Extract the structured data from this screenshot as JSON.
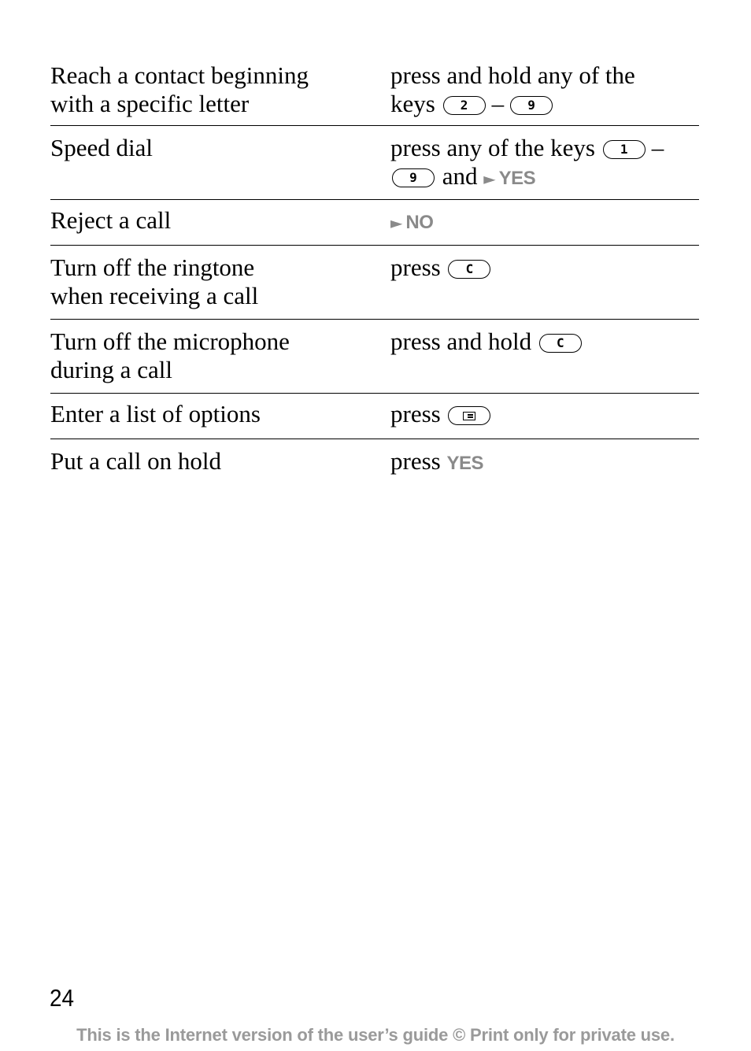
{
  "document": {
    "rows": [
      {
        "action": "Reach a contact beginning with a specific letter",
        "action_line1": "Reach a contact beginning",
        "action_line2": "with a specific letter",
        "how_line1": "press and hold any of the",
        "how_prefix": "keys",
        "key_from": "2",
        "range_dash": "–",
        "key_to": "9"
      },
      {
        "action": "Speed dial",
        "how_prefix": "press any of the keys",
        "key_from": "1",
        "range_dash": "–",
        "key_to": "9",
        "connector": "and",
        "soft_arrow": "►",
        "soft_key": "YES"
      },
      {
        "action": "Reject a call",
        "soft_arrow": "►",
        "soft_key": "NO"
      },
      {
        "action_line1": "Turn off the ringtone",
        "action_line2": "when receiving a call",
        "how_prefix": "press",
        "key": "C"
      },
      {
        "action_line1": "Turn off the microphone",
        "action_line2": "during a call",
        "how_prefix": "press and hold",
        "key": "C"
      },
      {
        "action": "Enter a list of options",
        "how_prefix": "press",
        "key_icon": "options-menu-key-icon"
      },
      {
        "action": "Put a call on hold",
        "how_prefix": "press",
        "soft_key": "YES"
      }
    ],
    "colors": {
      "text": "#000000",
      "soft_key": "#8a8a8a",
      "footer": "#9a9a9a"
    }
  },
  "page": {
    "number": "24",
    "footer": "This is the Internet version of the user’s guide © Print only for private use."
  }
}
